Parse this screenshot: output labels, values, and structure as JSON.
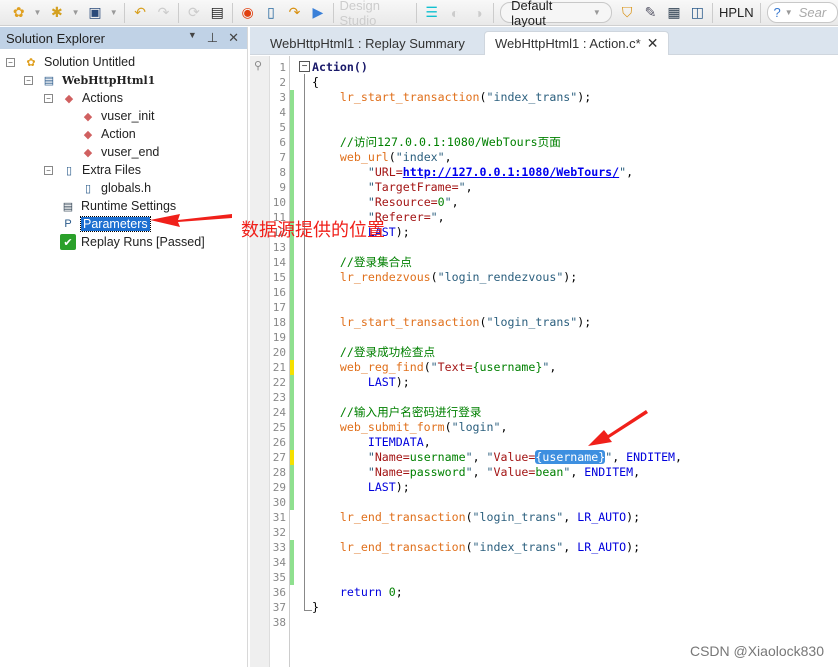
{
  "toolbar": {
    "design_studio": "Design Studio",
    "layout": "Default layout",
    "hpln": "HPLN",
    "search_placeholder": "Sear"
  },
  "explorer": {
    "title": "Solution Explorer",
    "items": [
      {
        "label": "Solution Untitled",
        "icon": "solution-icon"
      },
      {
        "label": "WebHttpHtml1",
        "icon": "script-icon"
      },
      {
        "label": "Actions",
        "icon": "actions-icon"
      },
      {
        "label": "vuser_init",
        "icon": "action-icon"
      },
      {
        "label": "Action",
        "icon": "action-icon"
      },
      {
        "label": "vuser_end",
        "icon": "action-icon"
      },
      {
        "label": "Extra Files",
        "icon": "files-icon"
      },
      {
        "label": "globals.h",
        "icon": "file-icon"
      },
      {
        "label": "Runtime Settings",
        "icon": "settings-icon"
      },
      {
        "label": "Parameters",
        "icon": "parameters-icon",
        "selected": true
      },
      {
        "label": "Replay Runs [Passed]",
        "icon": "check-icon"
      }
    ]
  },
  "tabs": [
    {
      "label": "WebHttpHtml1 : Replay Summary",
      "active": false
    },
    {
      "label": "WebHttpHtml1 : Action.c*",
      "active": true
    }
  ],
  "annotation": "数据源提供的位置",
  "watermark": "CSDN @Xiaolock830",
  "code": [
    {
      "m": "",
      "t": [
        [
          "bold",
          "Action()"
        ]
      ]
    },
    {
      "m": "",
      "t": [
        [
          "pl",
          "{"
        ]
      ]
    },
    {
      "m": "g",
      "t": [
        [
          "pl",
          "    "
        ],
        [
          "fn",
          "lr_start_transaction"
        ],
        [
          "pl",
          "("
        ],
        [
          "str",
          "\"index_trans\""
        ],
        [
          "pl",
          ");"
        ]
      ]
    },
    {
      "m": "g",
      "t": []
    },
    {
      "m": "g",
      "t": []
    },
    {
      "m": "g",
      "t": [
        [
          "pl",
          "    "
        ],
        [
          "cm",
          "//访问127.0.0.1:1080/WebTours页面"
        ]
      ]
    },
    {
      "m": "g",
      "t": [
        [
          "pl",
          "    "
        ],
        [
          "fn",
          "web_url"
        ],
        [
          "pl",
          "("
        ],
        [
          "str",
          "\"index\""
        ],
        [
          "pl",
          ","
        ]
      ]
    },
    {
      "m": "g",
      "t": [
        [
          "pl",
          "        "
        ],
        [
          "str",
          "\""
        ],
        [
          "key",
          "URL="
        ],
        [
          "url",
          "http://127.0.0.1:1080/WebTours/"
        ],
        [
          "str",
          "\""
        ],
        [
          "pl",
          ","
        ]
      ]
    },
    {
      "m": "g",
      "t": [
        [
          "pl",
          "        "
        ],
        [
          "str",
          "\""
        ],
        [
          "key",
          "TargetFrame="
        ],
        [
          "str",
          "\""
        ],
        [
          "pl",
          ","
        ]
      ]
    },
    {
      "m": "g",
      "t": [
        [
          "pl",
          "        "
        ],
        [
          "str",
          "\""
        ],
        [
          "key",
          "Resource="
        ],
        [
          "val",
          "0"
        ],
        [
          "str",
          "\""
        ],
        [
          "pl",
          ","
        ]
      ]
    },
    {
      "m": "g",
      "t": [
        [
          "pl",
          "        "
        ],
        [
          "str",
          "\""
        ],
        [
          "key",
          "Referer="
        ],
        [
          "str",
          "\""
        ],
        [
          "pl",
          ","
        ]
      ]
    },
    {
      "m": "g",
      "t": [
        [
          "pl",
          "        "
        ],
        [
          "kw",
          "LAST"
        ],
        [
          "pl",
          ");"
        ]
      ]
    },
    {
      "m": "g",
      "t": []
    },
    {
      "m": "g",
      "t": [
        [
          "pl",
          "    "
        ],
        [
          "cm",
          "//登录集合点"
        ]
      ]
    },
    {
      "m": "g",
      "t": [
        [
          "pl",
          "    "
        ],
        [
          "fn",
          "lr_rendezvous"
        ],
        [
          "pl",
          "("
        ],
        [
          "str",
          "\"login_rendezvous\""
        ],
        [
          "pl",
          ");"
        ]
      ]
    },
    {
      "m": "g",
      "t": []
    },
    {
      "m": "g",
      "t": []
    },
    {
      "m": "g",
      "t": [
        [
          "pl",
          "    "
        ],
        [
          "fn",
          "lr_start_transaction"
        ],
        [
          "pl",
          "("
        ],
        [
          "str",
          "\"login_trans\""
        ],
        [
          "pl",
          ");"
        ]
      ]
    },
    {
      "m": "g",
      "t": []
    },
    {
      "m": "g",
      "t": [
        [
          "pl",
          "    "
        ],
        [
          "cm",
          "//登录成功检查点"
        ]
      ]
    },
    {
      "m": "y",
      "t": [
        [
          "pl",
          "    "
        ],
        [
          "fn",
          "web_reg_find"
        ],
        [
          "pl",
          "("
        ],
        [
          "str",
          "\""
        ],
        [
          "key",
          "Text="
        ],
        [
          "val",
          "{username}"
        ],
        [
          "str",
          "\""
        ],
        [
          "pl",
          ","
        ]
      ]
    },
    {
      "m": "g",
      "t": [
        [
          "pl",
          "        "
        ],
        [
          "kw",
          "LAST"
        ],
        [
          "pl",
          ");"
        ]
      ]
    },
    {
      "m": "g",
      "t": []
    },
    {
      "m": "g",
      "t": [
        [
          "pl",
          "    "
        ],
        [
          "cm",
          "//输入用户名密码进行登录"
        ]
      ]
    },
    {
      "m": "g",
      "t": [
        [
          "pl",
          "    "
        ],
        [
          "fn",
          "web_submit_form"
        ],
        [
          "pl",
          "("
        ],
        [
          "str",
          "\"login\""
        ],
        [
          "pl",
          ","
        ]
      ]
    },
    {
      "m": "g",
      "t": [
        [
          "pl",
          "        "
        ],
        [
          "kw",
          "ITEMDATA"
        ],
        [
          "pl",
          ","
        ]
      ]
    },
    {
      "m": "y",
      "t": [
        [
          "pl",
          "        "
        ],
        [
          "str",
          "\""
        ],
        [
          "key",
          "Name="
        ],
        [
          "val",
          "username"
        ],
        [
          "str",
          "\""
        ],
        [
          "pl",
          ", "
        ],
        [
          "str",
          "\""
        ],
        [
          "key",
          "Value="
        ],
        [
          "hl",
          "{username}"
        ],
        [
          "str",
          "\""
        ],
        [
          "pl",
          ", "
        ],
        [
          "kw",
          "ENDITEM"
        ],
        [
          "pl",
          ","
        ]
      ]
    },
    {
      "m": "g",
      "t": [
        [
          "pl",
          "        "
        ],
        [
          "str",
          "\""
        ],
        [
          "key",
          "Name="
        ],
        [
          "val",
          "password"
        ],
        [
          "str",
          "\""
        ],
        [
          "pl",
          ", "
        ],
        [
          "str",
          "\""
        ],
        [
          "key",
          "Value="
        ],
        [
          "val",
          "bean"
        ],
        [
          "str",
          "\""
        ],
        [
          "pl",
          ", "
        ],
        [
          "kw",
          "ENDITEM"
        ],
        [
          "pl",
          ","
        ]
      ]
    },
    {
      "m": "g",
      "t": [
        [
          "pl",
          "        "
        ],
        [
          "kw",
          "LAST"
        ],
        [
          "pl",
          ");"
        ]
      ]
    },
    {
      "m": "g",
      "t": []
    },
    {
      "m": "",
      "t": [
        [
          "pl",
          "    "
        ],
        [
          "fn",
          "lr_end_transaction"
        ],
        [
          "pl",
          "("
        ],
        [
          "str",
          "\"login_trans\""
        ],
        [
          "pl",
          ", "
        ],
        [
          "kw",
          "LR_AUTO"
        ],
        [
          "pl",
          ");"
        ]
      ]
    },
    {
      "m": "",
      "t": []
    },
    {
      "m": "g",
      "t": [
        [
          "pl",
          "    "
        ],
        [
          "fn",
          "lr_end_transaction"
        ],
        [
          "pl",
          "("
        ],
        [
          "str",
          "\"index_trans\""
        ],
        [
          "pl",
          ", "
        ],
        [
          "kw",
          "LR_AUTO"
        ],
        [
          "pl",
          ");"
        ]
      ]
    },
    {
      "m": "g",
      "t": []
    },
    {
      "m": "g",
      "t": []
    },
    {
      "m": "",
      "t": [
        [
          "pl",
          "    "
        ],
        [
          "kw",
          "return"
        ],
        [
          "pl",
          " "
        ],
        [
          "val",
          "0"
        ],
        [
          "pl",
          ";"
        ]
      ]
    },
    {
      "m": "",
      "t": [
        [
          "pl",
          "}"
        ]
      ]
    },
    {
      "m": "",
      "t": []
    }
  ]
}
